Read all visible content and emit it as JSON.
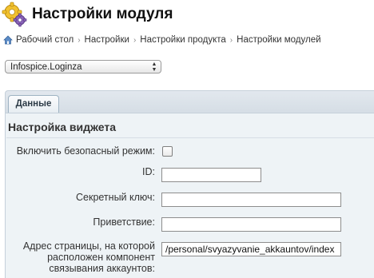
{
  "header": {
    "title": "Настройки модуля",
    "icon": "gear-icon"
  },
  "breadcrumb": {
    "home_icon": "home-icon",
    "items": [
      "Рабочий стол",
      "Настройки",
      "Настройки продукта",
      "Настройки модулей"
    ],
    "separator": "›"
  },
  "site_select": {
    "value": "Infospice.Loginza"
  },
  "tabs": [
    {
      "label": "Данные",
      "active": true
    }
  ],
  "section": {
    "title": "Настройка виджета"
  },
  "form": {
    "safe_mode_label": "Включить безопасный режим:",
    "safe_mode_checked": false,
    "id_label": "ID:",
    "id_value": "",
    "secret_label": "Секретный ключ:",
    "secret_value": "",
    "greeting_label": "Приветствие:",
    "greeting_value": "",
    "address_label_line1": "Адрес страницы, на которой",
    "address_label_line2": "расположен компонент",
    "address_label_line3": "связывания аккаунтов:",
    "address_value": "/personal/svyazyvanie_akkauntov/index"
  },
  "colors": {
    "panel_bg": "#eef3f6",
    "tab_border": "#9fb3c3",
    "gear_yellow": "#f2c230",
    "gear_purple": "#8a63b8"
  }
}
